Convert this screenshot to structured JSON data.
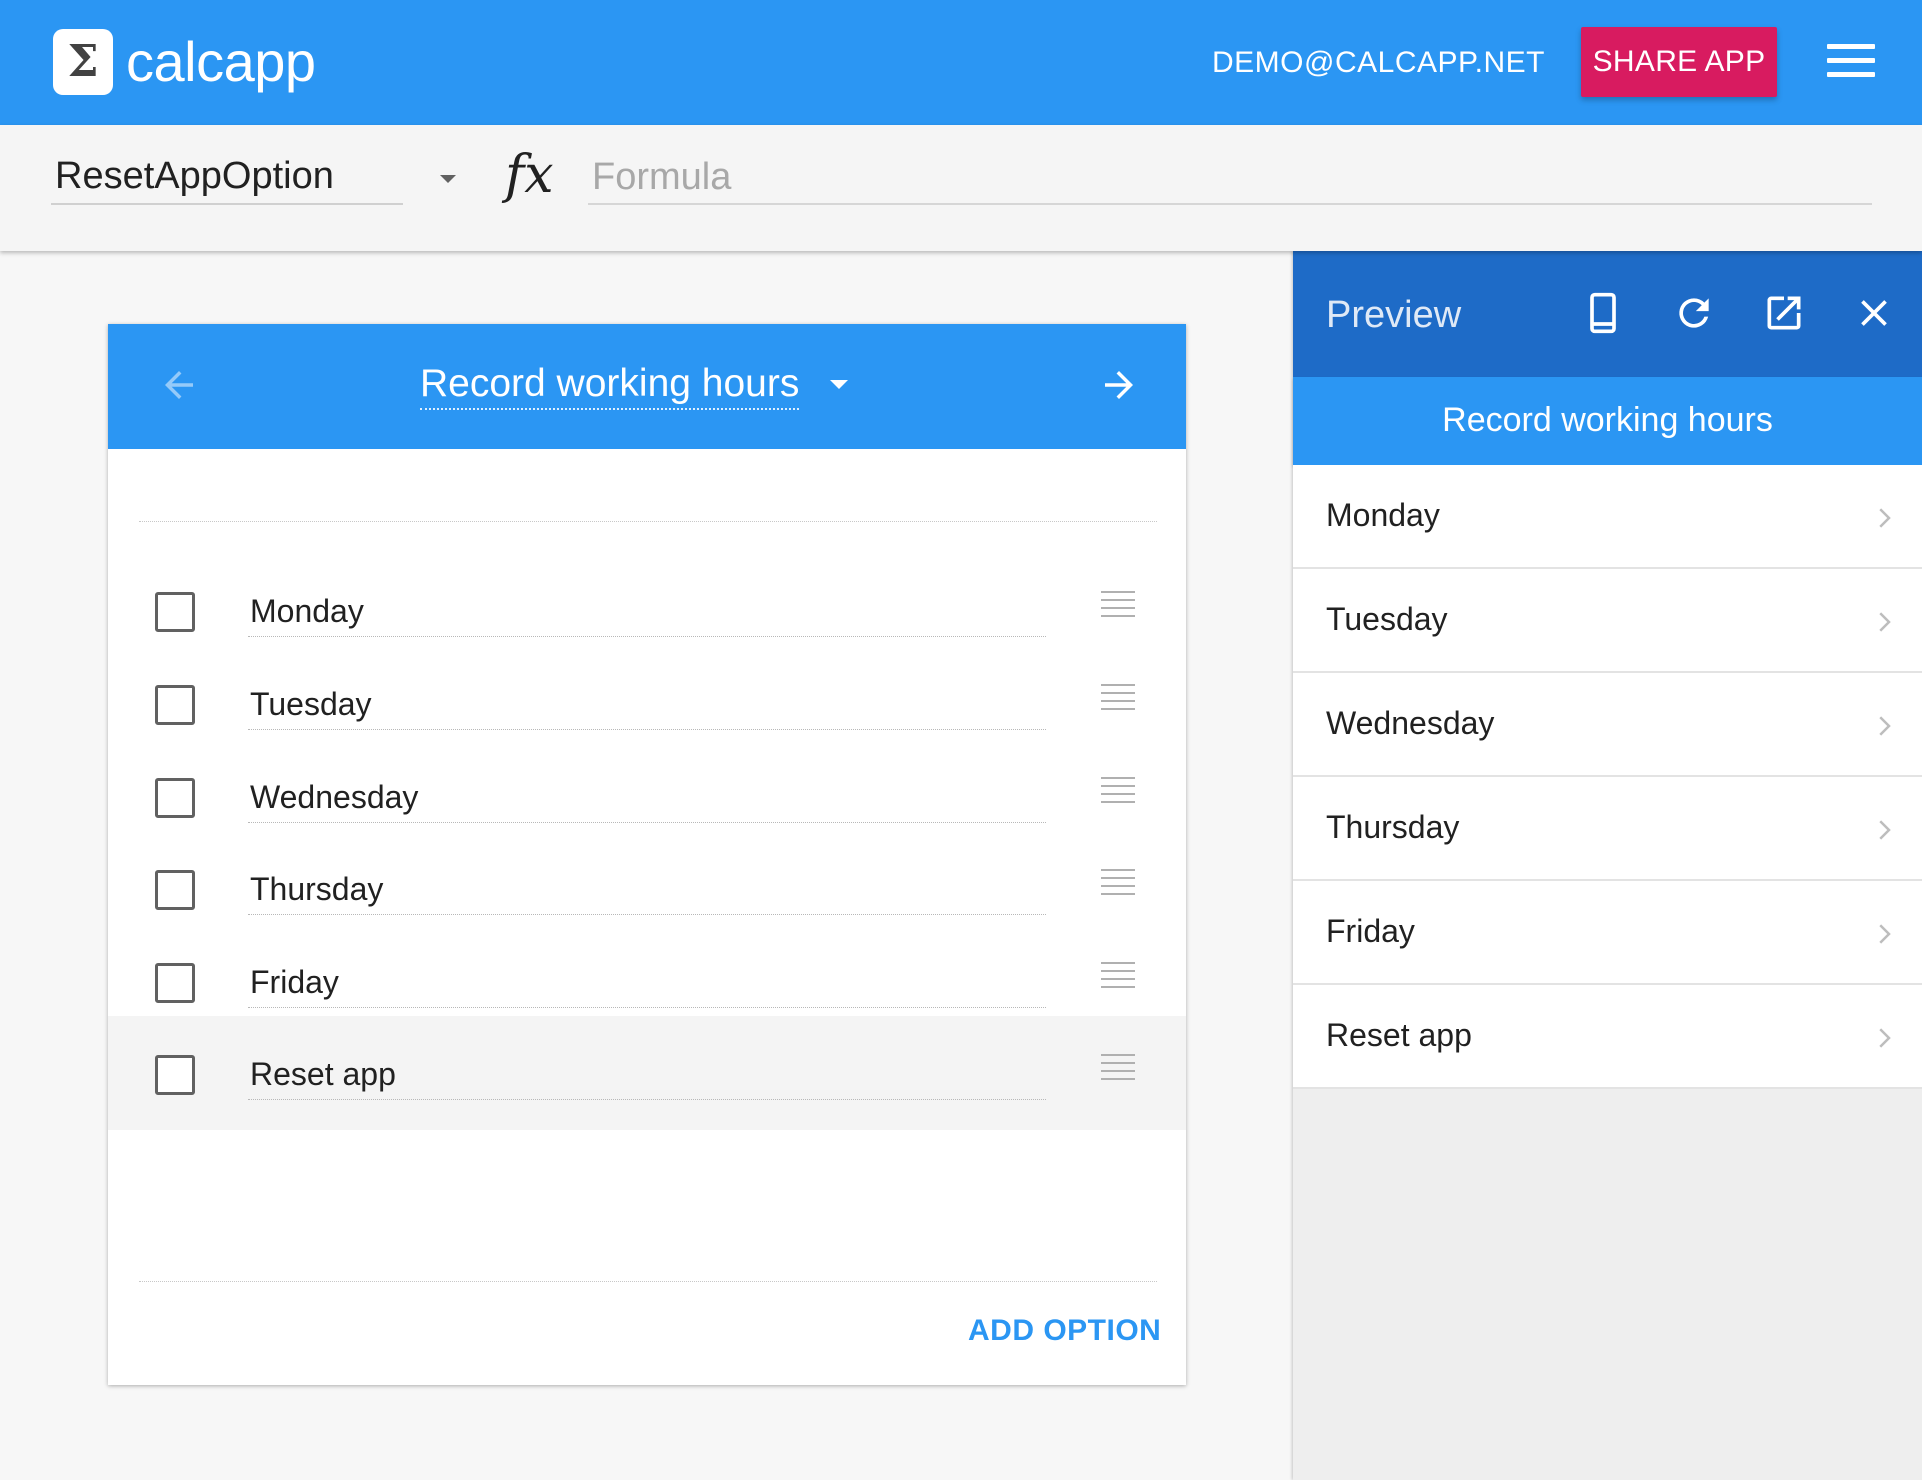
{
  "topbar": {
    "logo_glyph": "Σ",
    "brand": "calcapp",
    "account": "DEMO@CALCAPP.NET",
    "share_label": "SHARE APP",
    "accent_color": "#2b96f3",
    "share_color": "#d81b60"
  },
  "formula_bar": {
    "selected_field": "ResetAppOption",
    "fx_label": "fx",
    "formula_placeholder": "Formula",
    "formula_value": ""
  },
  "editor": {
    "screen_title": "Record working hours",
    "options": [
      {
        "label": "Monday",
        "checked": false
      },
      {
        "label": "Tuesday",
        "checked": false
      },
      {
        "label": "Wednesday",
        "checked": false
      },
      {
        "label": "Thursday",
        "checked": false
      },
      {
        "label": "Friday",
        "checked": false
      },
      {
        "label": "Reset app",
        "checked": false
      }
    ],
    "add_option_label": "ADD OPTION"
  },
  "preview": {
    "title": "Preview",
    "screen_title": "Record working hours",
    "header_color": "#1e6bc7",
    "items": [
      {
        "label": "Monday"
      },
      {
        "label": "Tuesday"
      },
      {
        "label": "Wednesday"
      },
      {
        "label": "Thursday"
      },
      {
        "label": "Friday"
      },
      {
        "label": "Reset app"
      }
    ]
  }
}
